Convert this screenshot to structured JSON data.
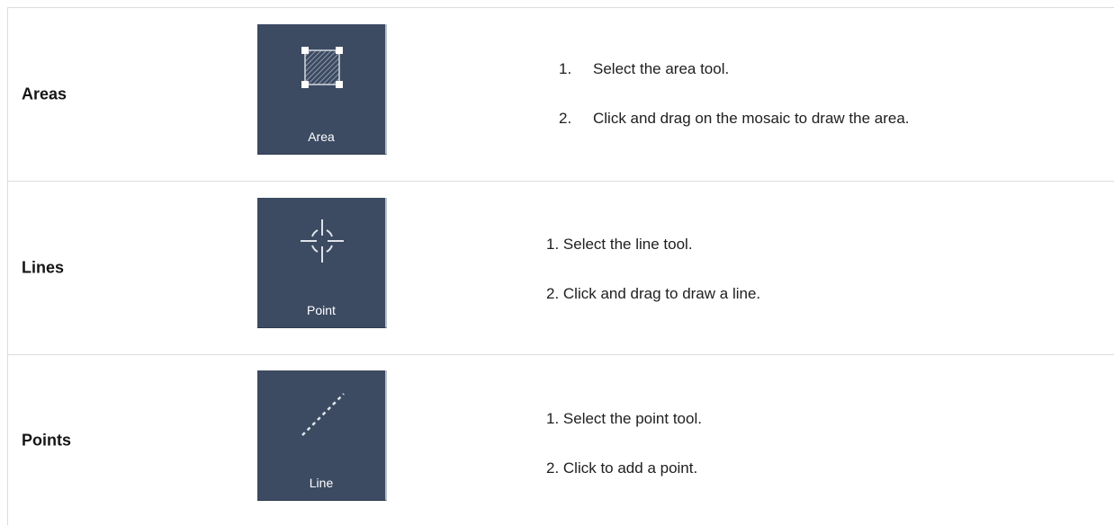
{
  "rows": [
    {
      "label": "Areas",
      "tool": {
        "label": "Area",
        "icon": "area-tool-icon"
      },
      "steps": [
        {
          "num": "1.",
          "text": "Select the area tool."
        },
        {
          "num": "2.",
          "text": "Click and drag on the mosaic to draw the area."
        }
      ]
    },
    {
      "label": "Lines",
      "tool": {
        "label": "Point",
        "icon": "crosshair-icon"
      },
      "steps": [
        {
          "text": "1. Select the line tool."
        },
        {
          "text": "2. Click and drag to draw a line."
        }
      ]
    },
    {
      "label": "Points",
      "tool": {
        "label": "Line",
        "icon": "dashed-line-icon"
      },
      "steps": [
        {
          "text": "1. Select the point tool."
        },
        {
          "text": "2. Click to add a point."
        }
      ]
    }
  ],
  "colors": {
    "tool_background": "#3c4a62",
    "tool_text": "#ffffff",
    "border": "#dcdcdc"
  }
}
